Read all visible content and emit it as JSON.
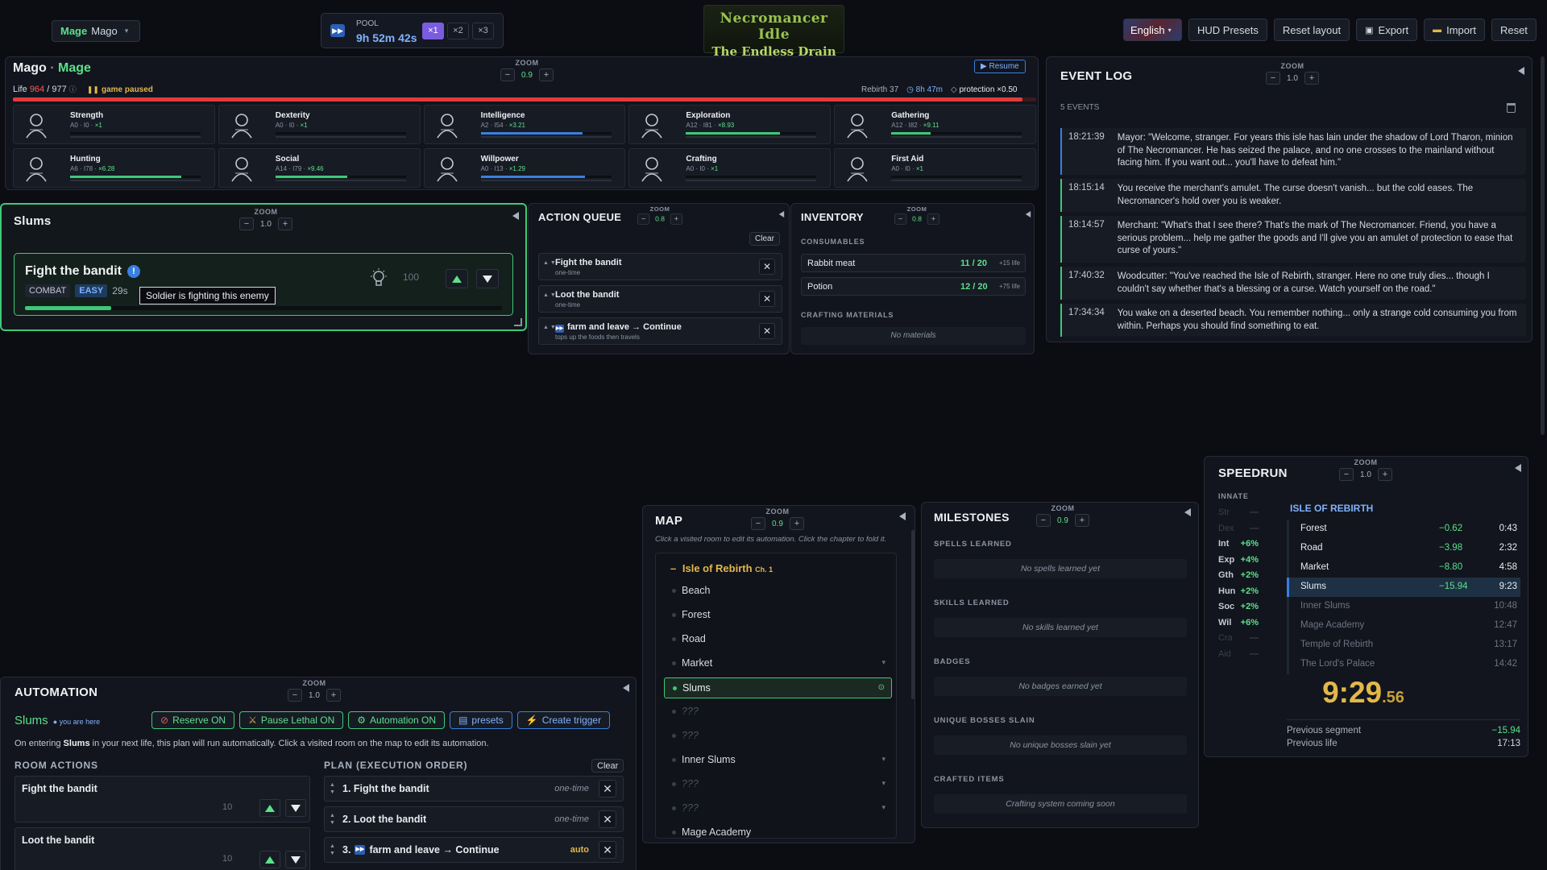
{
  "topbar": {
    "char_class": "Mage",
    "char_name": "Mago",
    "pool_label": "POOL",
    "pool_time": "9h 52m 42s",
    "speeds": [
      "×1",
      "×2",
      "×3"
    ],
    "logo_line1": "Necromancer Idle",
    "logo_line2": "The Endless Drain",
    "language": "English",
    "hud_presets": "HUD Presets",
    "reset_layout": "Reset layout",
    "export": "Export",
    "import": "Import",
    "reset": "Reset"
  },
  "character": {
    "name": "Mago",
    "sep": "·",
    "class": "Mage",
    "zoom_label": "ZOOM",
    "zoom": "0.9",
    "resume": "▶ Resume",
    "life_label": "Life",
    "life_cur": "964",
    "life_max": "/ 977",
    "paused": "game paused",
    "rebirth": "Rebirth 37",
    "time": "8h 47m",
    "protection": "protection ×0.50",
    "life_frac": 0.987,
    "stats": [
      {
        "name": "Strength",
        "sub": "A0 · I0 · ",
        "mult": "×1",
        "fill": 0,
        "icon": "strength-icon"
      },
      {
        "name": "Dexterity",
        "sub": "A0 · I0 · ",
        "mult": "×1",
        "fill": 0,
        "icon": "dexterity-icon"
      },
      {
        "name": "Intelligence",
        "sub": "A2 · I54 · ",
        "mult": "×3.21",
        "fill": 0.78,
        "icon": "intelligence-icon"
      },
      {
        "name": "Exploration",
        "sub": "A12 · I81 · ",
        "mult": "×8.93",
        "fill": 0.72,
        "icon": "exploration-icon"
      },
      {
        "name": "Gathering",
        "sub": "A12 · I82 · ",
        "mult": "×9.11",
        "fill": 0.3,
        "icon": "gathering-icon"
      },
      {
        "name": "Hunting",
        "sub": "A6 · I78 · ",
        "mult": "×6.28",
        "fill": 0.85,
        "icon": "hunting-icon"
      },
      {
        "name": "Social",
        "sub": "A14 · I79 · ",
        "mult": "×9.46",
        "fill": 0.55,
        "icon": "social-icon"
      },
      {
        "name": "Willpower",
        "sub": "A0 · I13 · ",
        "mult": "×1.29",
        "fill": 0.8,
        "icon": "willpower-icon"
      },
      {
        "name": "Crafting",
        "sub": "A0 · I0 · ",
        "mult": "×1",
        "fill": 0,
        "icon": "crafting-icon"
      },
      {
        "name": "First Aid",
        "sub": "A0 · I0 · ",
        "mult": "×1",
        "fill": 0,
        "icon": "first-aid-icon"
      }
    ]
  },
  "room": {
    "title": "Slums",
    "zoom_label": "ZOOM",
    "zoom": "1.0",
    "action": "Fight the bandit",
    "tag_combat": "COMBAT",
    "tag_easy": "EASY",
    "duration": "29s",
    "tooltip": "Soldier is fighting this enemy",
    "qty": "100",
    "progress": 0.18
  },
  "queue": {
    "title": "ACTION QUEUE",
    "zoom_label": "ZOOM",
    "zoom": "0.8",
    "clear": "Clear",
    "items": [
      {
        "name": "Fight the bandit",
        "sub": "one-time",
        "auto": false
      },
      {
        "name": "Loot the bandit",
        "sub": "one-time",
        "auto": false
      },
      {
        "name": "farm and leave → Continue",
        "sub": "tops up the foods then travels",
        "auto": true
      }
    ]
  },
  "inventory": {
    "title": "INVENTORY",
    "zoom_label": "ZOOM",
    "zoom": "0.8",
    "consumables_label": "CONSUMABLES",
    "items": [
      {
        "name": "Rabbit meat",
        "count": "11 / 20",
        "bonus": "+15 life"
      },
      {
        "name": "Potion",
        "count": "12 / 20",
        "bonus": "+75 life"
      }
    ],
    "crafting_label": "CRAFTING MATERIALS",
    "no_materials": "No materials"
  },
  "eventlog": {
    "title": "EVENT LOG",
    "zoom_label": "ZOOM",
    "zoom": "1.0",
    "count": "5 EVENTS",
    "events": [
      {
        "time": "18:21:39",
        "text": "Mayor: \"Welcome, stranger. For years this isle has lain under the shadow of Lord Tharon, minion of The Necromancer. He has seized the palace, and no one crosses to the mainland without facing him. If you want out... you'll have to defeat him.\""
      },
      {
        "time": "18:15:14",
        "text": "You receive the merchant's amulet. The curse doesn't vanish... but the cold eases. The Necromancer's hold over you is weaker."
      },
      {
        "time": "18:14:57",
        "text": "Merchant: \"What's that I see there? That's the mark of The Necromancer. Friend, you have a serious problem... help me gather the goods and I'll give you an amulet of protection to ease that curse of yours.\""
      },
      {
        "time": "17:40:32",
        "text": "Woodcutter: \"You've reached the Isle of Rebirth, stranger. Here no one truly dies... though I couldn't say whether that's a blessing or a curse. Watch yourself on the road.\""
      },
      {
        "time": "17:34:34",
        "text": "You wake on a deserted beach. You remember nothing... only a strange cold consuming you from within. Perhaps you should find something to eat."
      }
    ]
  },
  "automation": {
    "title": "AUTOMATION",
    "zoom_label": "ZOOM",
    "zoom": "1.0",
    "room": "Slums",
    "here": "you are here",
    "reserve": "Reserve ON",
    "pause": "Pause Lethal ON",
    "auto": "Automation ON",
    "presets": "presets",
    "trigger": "Create trigger",
    "desc_a": "On entering ",
    "desc_room": "Slums",
    "desc_b": " in your next life, this plan will run automatically. Click a visited room on the map to edit its automation.",
    "room_actions_label": "ROOM ACTIONS",
    "plan_label": "PLAN (EXECUTION ORDER)",
    "clear": "Clear",
    "room_actions": [
      {
        "name": "Fight the bandit",
        "qty": "10"
      },
      {
        "name": "Loot the bandit",
        "qty": "10"
      }
    ],
    "plan": [
      {
        "name": "1. Fight the bandit",
        "mode": "one-time",
        "auto": false
      },
      {
        "name": "2. Loot the bandit",
        "mode": "one-time",
        "auto": false
      },
      {
        "name": "3.",
        "name2": "farm and leave → Continue",
        "mode": "auto",
        "auto": true
      }
    ]
  },
  "map": {
    "title": "MAP",
    "zoom_label": "ZOOM",
    "zoom": "0.9",
    "hint": "Click a visited room to edit its automation. Click the chapter to fold it.",
    "chapter": "Isle of Rebirth",
    "chapter_tag": "Ch. 1",
    "rooms": [
      "Beach",
      "Forest",
      "Road",
      "Market",
      "Slums",
      "???",
      "???",
      "Inner Slums",
      "???",
      "???",
      "Mage Academy"
    ]
  },
  "milestones": {
    "title": "MILESTONES",
    "zoom_label": "ZOOM",
    "zoom": "0.9",
    "sections": [
      {
        "label": "SPELLS LEARNED",
        "empty": "No spells learned yet"
      },
      {
        "label": "SKILLS LEARNED",
        "empty": "No skills learned yet"
      },
      {
        "label": "BADGES",
        "empty": "No badges earned yet"
      },
      {
        "label": "UNIQUE BOSSES SLAIN",
        "empty": "No unique bosses slain yet"
      },
      {
        "label": "CRAFTED ITEMS",
        "empty": "Crafting system coming soon"
      }
    ]
  },
  "speedrun": {
    "title": "SPEEDRUN",
    "zoom_label": "ZOOM",
    "zoom": "1.0",
    "innate_label": "INNATE",
    "innate": [
      {
        "k": "Str",
        "v": "—"
      },
      {
        "k": "Dex",
        "v": "—"
      },
      {
        "k": "Int",
        "v": "+6%"
      },
      {
        "k": "Exp",
        "v": "+4%"
      },
      {
        "k": "Gth",
        "v": "+2%"
      },
      {
        "k": "Hun",
        "v": "+2%"
      },
      {
        "k": "Soc",
        "v": "+2%"
      },
      {
        "k": "Wil",
        "v": "+6%"
      },
      {
        "k": "Cra",
        "v": "—"
      },
      {
        "k": "Aid",
        "v": "—"
      }
    ],
    "chapter": "ISLE OF REBIRTH",
    "splits": [
      {
        "n": "Forest",
        "d": "−0.62",
        "t": "0:43"
      },
      {
        "n": "Road",
        "d": "−3.98",
        "t": "2:32"
      },
      {
        "n": "Market",
        "d": "−8.80",
        "t": "4:58"
      },
      {
        "n": "Slums",
        "d": "−15.94",
        "t": "9:23"
      },
      {
        "n": "Inner Slums",
        "d": "",
        "t": "10:48"
      },
      {
        "n": "Mage Academy",
        "d": "",
        "t": "12:47"
      },
      {
        "n": "Temple of Rebirth",
        "d": "",
        "t": "13:17"
      },
      {
        "n": "The Lord's Palace",
        "d": "",
        "t": "14:42"
      }
    ],
    "timer": "9:29",
    "timer_ms": ".56",
    "prev_seg_label": "Previous segment",
    "prev_seg": "−15.94",
    "prev_life_label": "Previous life",
    "prev_life": "17:13"
  }
}
